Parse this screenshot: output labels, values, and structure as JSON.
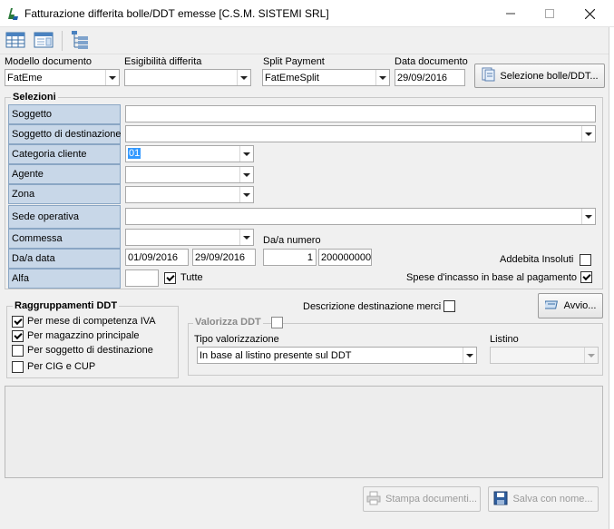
{
  "window": {
    "title": "Fatturazione differita bolle/DDT emesse [C.S.M. SISTEMI SRL]",
    "minimize": "—",
    "maximize": "☐",
    "close": "✕"
  },
  "header": {
    "modello_label": "Modello documento",
    "modello_value": "FatEme",
    "esigibilita_label": "Esigibilità differita",
    "esigibilita_value": "",
    "split_label": "Split Payment",
    "split_value": "FatEmeSplit",
    "data_label": "Data documento",
    "data_value": "29/09/2016",
    "selezione_button": "Selezione bolle/DDT..."
  },
  "selezioni": {
    "title": "Selezioni",
    "soggetto": "Soggetto",
    "soggetto_dest": "Soggetto di destinazione",
    "categoria": "Categoria cliente",
    "categoria_value": "01",
    "agente": "Agente",
    "zona": "Zona",
    "sede": "Sede operativa",
    "commessa": "Commessa",
    "da_data": "Da/a data",
    "da_data_from": "01/09/2016",
    "da_data_to": "29/09/2016",
    "da_numero_label": "Da/a numero",
    "numero_from": "1",
    "numero_to": "200000000",
    "alfa": "Alfa",
    "tutte": "Tutte",
    "addebita_insoluti": "Addebita Insoluti",
    "spese_incasso": "Spese d'incasso in base al pagamento"
  },
  "raggruppamenti": {
    "title": "Raggruppamenti DDT",
    "items": [
      {
        "label": "Per  mese di competenza IVA",
        "checked": true
      },
      {
        "label": "Per magazzino principale",
        "checked": true
      },
      {
        "label": "Per soggetto di destinazione",
        "checked": false
      },
      {
        "label": "Per CIG e CUP",
        "checked": false
      }
    ]
  },
  "descrizione_dest": "Descrizione destinazione merci",
  "avvio_button": "Avvio...",
  "valorizza": {
    "title": "Valorizza DDT",
    "tipo_label": "Tipo valorizzazione",
    "tipo_value": "In base al listino presente sul DDT",
    "listino_label": "Listino",
    "listino_value": ""
  },
  "footer": {
    "stampa_button": "Stampa documenti...",
    "salva_button": "Salva con nome..."
  },
  "colors": {
    "label_bg": "#c8d7e8",
    "selection": "#3399ff"
  }
}
